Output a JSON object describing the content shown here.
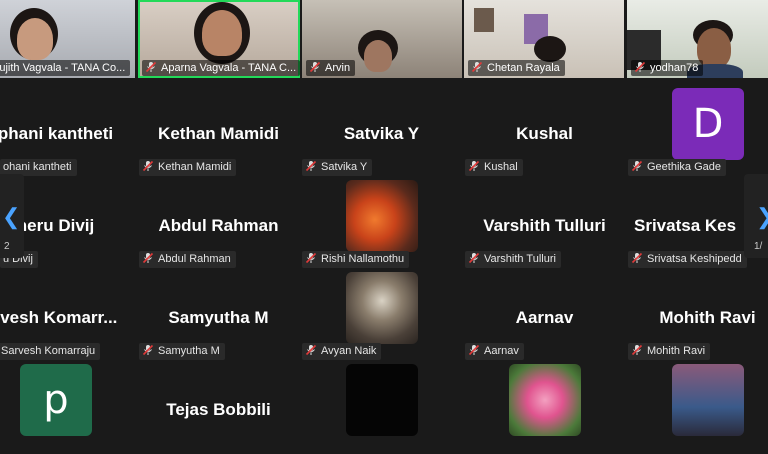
{
  "video_strip": [
    {
      "label": "Sujith Vagvala - TANA Co..."
    },
    {
      "label": "Aparna Vagvala - TANA C..."
    },
    {
      "label": "Arvin"
    },
    {
      "label": "Chetan Rayala"
    },
    {
      "label": "yodhan78"
    }
  ],
  "grid": {
    "row1": [
      {
        "name": "phani kantheti",
        "label": "ohani kantheti"
      },
      {
        "name": "Kethan Mamidi",
        "label": "Kethan Mamidi"
      },
      {
        "name": "Satvika Y",
        "label": "Satvika Y"
      },
      {
        "name": "Kushal",
        "label": "Kushal"
      },
      {
        "avatar_letter": "D",
        "label": "Geethika Gade"
      }
    ],
    "row2": [
      {
        "name": "neru Divij",
        "label": "u Divij"
      },
      {
        "name": "Abdul Rahman",
        "label": "Abdul Rahman"
      },
      {
        "label": "Rishi Nallamothu"
      },
      {
        "name": "Varshith Tulluri",
        "label": "Varshith Tulluri"
      },
      {
        "name": "Srivatsa  Kes",
        "label": "Srivatsa Keshipedd"
      }
    ],
    "row3": [
      {
        "name": "rvesh  Komarr...",
        "label": "Sarvesh Komarraju"
      },
      {
        "name": "Samyutha M",
        "label": "Samyutha M"
      },
      {
        "label": "Avyan Naik"
      },
      {
        "name": "Aarnav",
        "label": "Aarnav"
      },
      {
        "name": "Mohith Ravi",
        "label": "Mohith Ravi"
      }
    ],
    "row4": [
      {
        "avatar_letter": "p"
      },
      {
        "name": "Tejas Bobbili"
      },
      {},
      {},
      {}
    ]
  },
  "nav": {
    "left_page": "2",
    "right_page": "1/"
  },
  "colors": {
    "active_border": "#23d959",
    "avatar_d": "#7b2bb8",
    "avatar_p": "#1f6b4a",
    "mic_muted": "#e03a3a"
  }
}
